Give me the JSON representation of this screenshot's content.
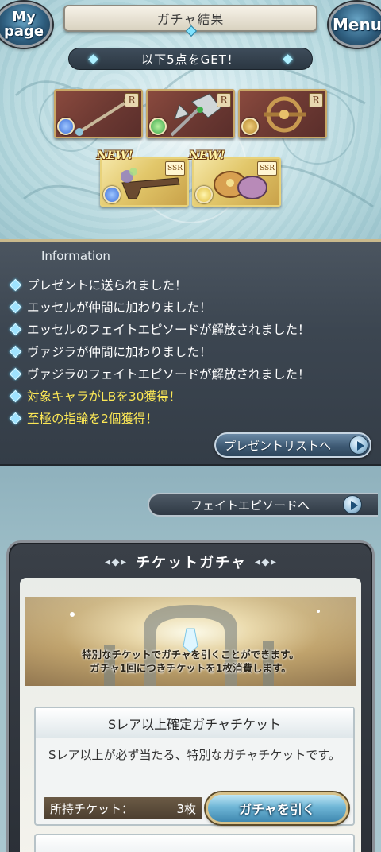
{
  "header": {
    "title": "ガチャ結果",
    "mypage_label": "My page",
    "menu_label": "Menu"
  },
  "result": {
    "banner": "以下5点をGET！",
    "items": [
      {
        "rarity": "R",
        "element": "water",
        "element_color": "#3d6fd8",
        "weapon": "staff-icon",
        "new": false
      },
      {
        "rarity": "R",
        "element": "wind",
        "element_color": "#3aa84a",
        "weapon": "axe-icon",
        "new": false
      },
      {
        "rarity": "R",
        "element": "earth",
        "element_color": "#b5862a",
        "weapon": "crossbow-icon",
        "new": false
      },
      {
        "rarity": "SSR",
        "element": "water",
        "element_color": "#3d6fd8",
        "weapon": "gun-icon",
        "new": true
      },
      {
        "rarity": "SSR",
        "element": "light",
        "element_color": "#e2c040",
        "weapon": "gauntlet-icon",
        "new": true
      }
    ],
    "new_label": "NEW!"
  },
  "information": {
    "title": "Information",
    "lines": [
      {
        "text": "プレゼントに送られました！",
        "highlight": false
      },
      {
        "text": "エッセルが仲間に加わりました！",
        "highlight": false
      },
      {
        "text": "エッセルのフェイトエピソードが解放されました！",
        "highlight": false
      },
      {
        "text": "ヴァジラが仲間に加わりました！",
        "highlight": false
      },
      {
        "text": "ヴァジラのフェイトエピソードが解放されました！",
        "highlight": false
      },
      {
        "text": "対象キャラがLBを30獲得！",
        "highlight": true
      },
      {
        "text": "至極の指輪を2個獲得！",
        "highlight": true
      }
    ],
    "present_button": "プレゼントリストへ"
  },
  "fate_button": "フェイトエピソードへ",
  "ticket_gacha": {
    "title": "チケットガチャ",
    "banner_lines": [
      "特別なチケットでガチャを引くことができます。",
      "ガチャ1回につきチケットを1枚消費します。"
    ],
    "card": {
      "title": "Sレア以上確定ガチャチケット",
      "description": "Sレア以上が必ず当たる、特別なガチャチケットです。",
      "owned_label": "所持チケット：",
      "owned_count": "3枚",
      "draw_button": "ガチャを引く"
    }
  },
  "colors": {
    "highlight_text": "#fbe756",
    "info_bg": "#3c4651",
    "accent_blue": "#9fe3ff"
  }
}
